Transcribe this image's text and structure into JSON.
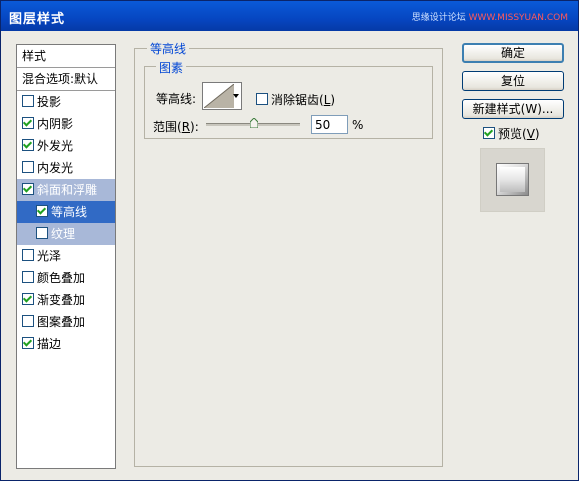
{
  "window": {
    "title": "图层样式",
    "watermark_prefix": "思缘设计论坛 ",
    "watermark_domain": "WWW.MISSYUAN.COM"
  },
  "style_list": {
    "header": "样式",
    "blend_options": "混合选项:默认",
    "items": [
      {
        "label": "投影",
        "checked": false
      },
      {
        "label": "内阴影",
        "checked": true
      },
      {
        "label": "外发光",
        "checked": true
      },
      {
        "label": "内发光",
        "checked": false
      },
      {
        "label": "斜面和浮雕",
        "checked": true
      },
      {
        "label": "等高线",
        "checked": true
      },
      {
        "label": "纹理",
        "checked": false
      },
      {
        "label": "光泽",
        "checked": false
      },
      {
        "label": "颜色叠加",
        "checked": false
      },
      {
        "label": "渐变叠加",
        "checked": true
      },
      {
        "label": "图案叠加",
        "checked": false
      },
      {
        "label": "描边",
        "checked": true
      }
    ]
  },
  "contour_panel": {
    "title": "等高线",
    "group_title": "图素",
    "contour_label": "等高线:",
    "antialias_label": "消除锯齿(",
    "antialias_key": "L",
    "antialias_suffix": ")",
    "antialias_checked": false,
    "range_label": "范围(",
    "range_key": "R",
    "range_suffix": "):",
    "range_value": "50",
    "range_unit": "%",
    "range_fraction": 0.5
  },
  "buttons": {
    "ok": "确定",
    "reset": "复位",
    "new_style": "新建样式(W)..."
  },
  "preview": {
    "label": "预览(",
    "key": "V",
    "suffix": ")",
    "checked": true
  }
}
